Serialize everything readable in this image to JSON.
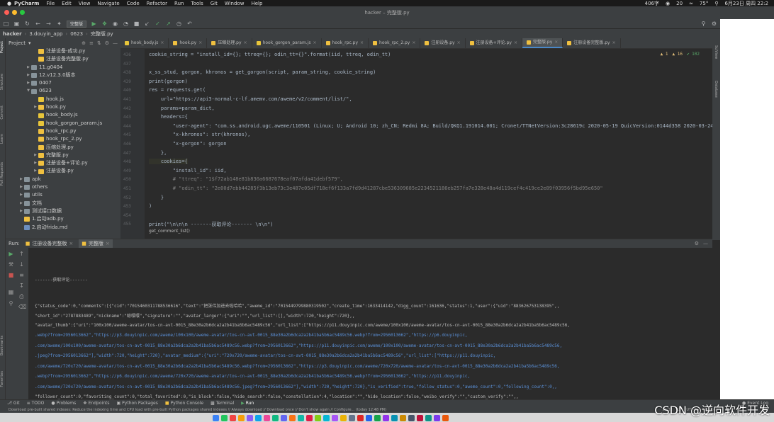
{
  "menubar": {
    "app": "PyCharm",
    "items": [
      "File",
      "Edit",
      "View",
      "Navigate",
      "Code",
      "Refactor",
      "Run",
      "Tools",
      "Git",
      "Window",
      "Help"
    ],
    "right": [
      "406字",
      "20",
      "75°",
      "6月23日 周四 22:2"
    ]
  },
  "window": {
    "title": "hacker – 完整版.py"
  },
  "toolbar": {
    "config": "完整版"
  },
  "navbar": {
    "parts": [
      "hacker",
      "3.douyin_app",
      "0623",
      "完整版.py"
    ]
  },
  "project": {
    "header": "Project",
    "items": [
      {
        "label": "注册设备-成功.py",
        "indent": 3,
        "type": "py",
        "arrow": false
      },
      {
        "label": "注册设备完整版.py",
        "indent": 3,
        "type": "py",
        "arrow": false
      },
      {
        "label": "11.g0404",
        "indent": 2,
        "type": "folder",
        "arrow": true
      },
      {
        "label": "12.v12.3.0版本",
        "indent": 2,
        "type": "folder",
        "arrow": true
      },
      {
        "label": "0407",
        "indent": 2,
        "type": "folder",
        "arrow": true
      },
      {
        "label": "0623",
        "indent": 2,
        "type": "folder",
        "arrow": true,
        "open": true
      },
      {
        "label": "hook.js",
        "indent": 3,
        "type": "js",
        "arrow": false
      },
      {
        "label": "hook.py",
        "indent": 3,
        "type": "py",
        "arrow": true
      },
      {
        "label": "hook_body.js",
        "indent": 3,
        "type": "js",
        "arrow": false
      },
      {
        "label": "hook_gorgon_param.js",
        "indent": 3,
        "type": "js",
        "arrow": false
      },
      {
        "label": "hook_rpc.py",
        "indent": 3,
        "type": "py",
        "arrow": false
      },
      {
        "label": "hook_rpc_2.py",
        "indent": 3,
        "type": "py",
        "arrow": false
      },
      {
        "label": "压缩处理.py",
        "indent": 3,
        "type": "py",
        "arrow": false
      },
      {
        "label": "完整版.py",
        "indent": 3,
        "type": "py",
        "arrow": true
      },
      {
        "label": "注册设备+评论.py",
        "indent": 3,
        "type": "py",
        "arrow": true
      },
      {
        "label": "注册设备.py",
        "indent": 3,
        "type": "py",
        "arrow": true
      },
      {
        "label": "apk",
        "indent": 1,
        "type": "folder",
        "arrow": true
      },
      {
        "label": "others",
        "indent": 1,
        "type": "folder",
        "arrow": true
      },
      {
        "label": "utils",
        "indent": 1,
        "type": "folder",
        "arrow": true
      },
      {
        "label": "文档",
        "indent": 1,
        "type": "folder",
        "arrow": true
      },
      {
        "label": "测试接口数据",
        "indent": 1,
        "type": "folder",
        "arrow": true
      },
      {
        "label": "1.启动adb.py",
        "indent": 1,
        "type": "py",
        "arrow": false
      },
      {
        "label": "2.启动frida.md",
        "indent": 1,
        "type": "md",
        "arrow": false
      }
    ]
  },
  "tabs": [
    "hook_body.js",
    "hook.py",
    "压缩处理.py",
    "hook_gorgon_param.js",
    "hook_rpc.py",
    "hook_rpc_2.py",
    "注册设备.py",
    "注册设备+评论.py",
    "完整版.py",
    "注册设备完整版.py"
  ],
  "active_tab": "完整版.py",
  "editor": {
    "info": [
      "▲ 1",
      "▲ 16",
      "✔ 102"
    ],
    "line_numbers": [
      "436",
      "437",
      "438",
      "439",
      "440",
      "441",
      "442",
      "443",
      "444",
      "445",
      "446",
      "447",
      "448",
      "449",
      "450",
      "451",
      "452",
      "453",
      "454",
      "455"
    ],
    "lines": [
      "cookie_string = \"install_id={}; ttreq={}; odin_tt={}\".format(iid, ttreq, odin_tt)",
      "",
      "x_ss_stud, gorgon, khronos = get_gorgon(script, param_string, cookie_string)",
      "print(gorgon)",
      "res = requests.get(",
      "    url=\"https://api3-normal-c-lf.amemv.com/aweme/v2/comment/list/\",",
      "    params=param_dict,",
      "    headers={",
      "        \"user-agent\": \"com.ss.android.ugc.aweme/110501 (Linux; U; Android 10; zh_CN; Redmi 8A; Build/QKQ1.191014.001; Cronet/TTNetVersion:3c28619c 2020-05-19 QuicVersion:0144d358 2020-03-24)\",",
      "        \"x-khronos\": str(khronos),",
      "        \"x-gorgon\": gorgon",
      "    },",
      "    cookies={",
      "        \"install_id\": iid,",
      "        # \"ttreq\": \"1$f72ab148e81b830a6687678eaf07afda41debf579\",",
      "        # \"odin_tt\": \"2e00d7ebb44285f3b13eb73c3e487e05df718ef6f133a7fd9d41287cbe536309685e2234521186eb257fa7e328e48a4d119cef4c419ce2e89f03956f5bd95e650\"",
      "    }",
      ")",
      "",
      "print(\"\\n\\n\\n -------获取评论------- \\n\\n\")"
    ],
    "breadcrumb": "get_comment_list()"
  },
  "run": {
    "label": "Run:",
    "tabs": [
      "注册设备完整版",
      "完整版"
    ]
  },
  "console": {
    "lines": [
      "-------获取评论-------",
      "{\"status_code\":0,\"comments\":[{\"cid\":\"7015460311788536616\",\"text\":\"把张伟加进去啦哈哈\",\"aweme_id\":\"7015449799880319502\",\"create_time\":1633414142,\"digg_count\":161636,\"status\":1,\"user\":{\"uid\":\"883626753138395\",,",
      "\"short_id\":\"2787883489\",\"nickname\":\"聪嘤嘤\",\"signature\":\"\",\"avatar_larger\":{\"uri\":\"\",\"url_list\":[],\"width\":720,\"height\":720},,",
      "\"avatar_thumb\":{\"uri\":\"100x100/aweme-avatar/tos-cn-avt-0015_88e30a2b6dca2a2b41ba5b6ac5489c56\",\"url_list\":[\"https://p11.douyinpic.com/aweme/100x100/aweme-avatar/tos-cn-avt-0015_88e30a2b6dca2a2b41ba5b6ac5489c56,",
      ".webp?from=2956013662\",\"https://p3.douyinpic.com/aweme/100x100/aweme-avatar/tos-cn-avt-0015_88e30a2b6dca2a2b41ba5b6ac5489c56.webp?from=2956013662\",\"https://p6.douyinpic,",
      ".com/aweme/100x100/aweme-avatar/tos-cn-avt-0015_88e30a2b6dca2a2b41ba5b6ac5489c56.webp?from=2956013662\",\"https://p11.douyinpic.com/aweme/100x100/aweme-avatar/tos-cn-avt-0015_88e30a2b6dca2a2b41ba5b6ac5489c56,",
      ".jpeg?from=2956013662\"],\"width\":720,\"height\":720},\"avatar_medium\":{\"uri\":\"720x720/aweme-avatar/tos-cn-avt-0015_88e30a2b6dca2a2b41ba5b6ac5489c56\",\"url_list\":[\"https://p11.douyinpic,",
      ".com/aweme/720x720/aweme-avatar/tos-cn-avt-0015_88e30a2b6dca2a2b41ba5b6ac5489c56.webp?from=2956013662\",\"https://p3.douyinpic.com/aweme/720x720/aweme-avatar/tos-cn-avt-0015_88e30a2b6dca2a2b41ba5b6ac5489c56,",
      ".webp?from=2956013662\",\"https://p6.douyinpic.com/aweme/720x720/aweme-avatar/tos-cn-avt-0015_88e30a2b6dca2a2b41ba5b6ac5489c56.webp?from=2956013662\",\"https://p11.douyinpic,",
      ".com/aweme/720x720/aweme-avatar/tos-cn-avt-0015_88e30a2b6dca2a2b41ba5b6ac5489c56.jpeg?from=2956013662\"],\"width\":720,\"height\":720},\"is_verified\":true,\"follow_status\":0,\"aweme_count\":0,\"following_count\":0,,",
      "\"follower_count\":0,\"favoriting_count\":0,\"total_favorited\":0,\"is_block\":false,\"hide_search\":false,\"constellation\":4,\"location\":\"\",\"hide_location\":false,\"weibo_verify\":\"\",\"custom_verify\":\"\",,",
      "\"unique_id\":\"kalijiang1479\",\"bind_phone\":\"\",\"special_lock\":1,\"need_recommend\":0,\"is_binded_weibo\":false,\"weibo_name\":\"\",\"weibo_schema\":\"\",\"weibo_url\":\"\",\"story_open\":false,\"story_count\":0,,"
    ]
  },
  "bottom_tools": [
    "Git",
    "TODO",
    "Problems",
    "Endpoints",
    "Python Packages",
    "Python Console",
    "Terminal",
    "Run"
  ],
  "event_log": "Event Log",
  "status": {
    "message": "Download pre-built shared indexes: Reduce the indexing time and CPU load with pre-built Python packages shared indexes // Always download // Download once // Don't show again // Configure... (today 12:48 PM)",
    "right": [
      "14:32",
      "LF",
      "UTF-8",
      "4 spaces"
    ]
  },
  "watermark": "CSDN @逆向软件开发"
}
